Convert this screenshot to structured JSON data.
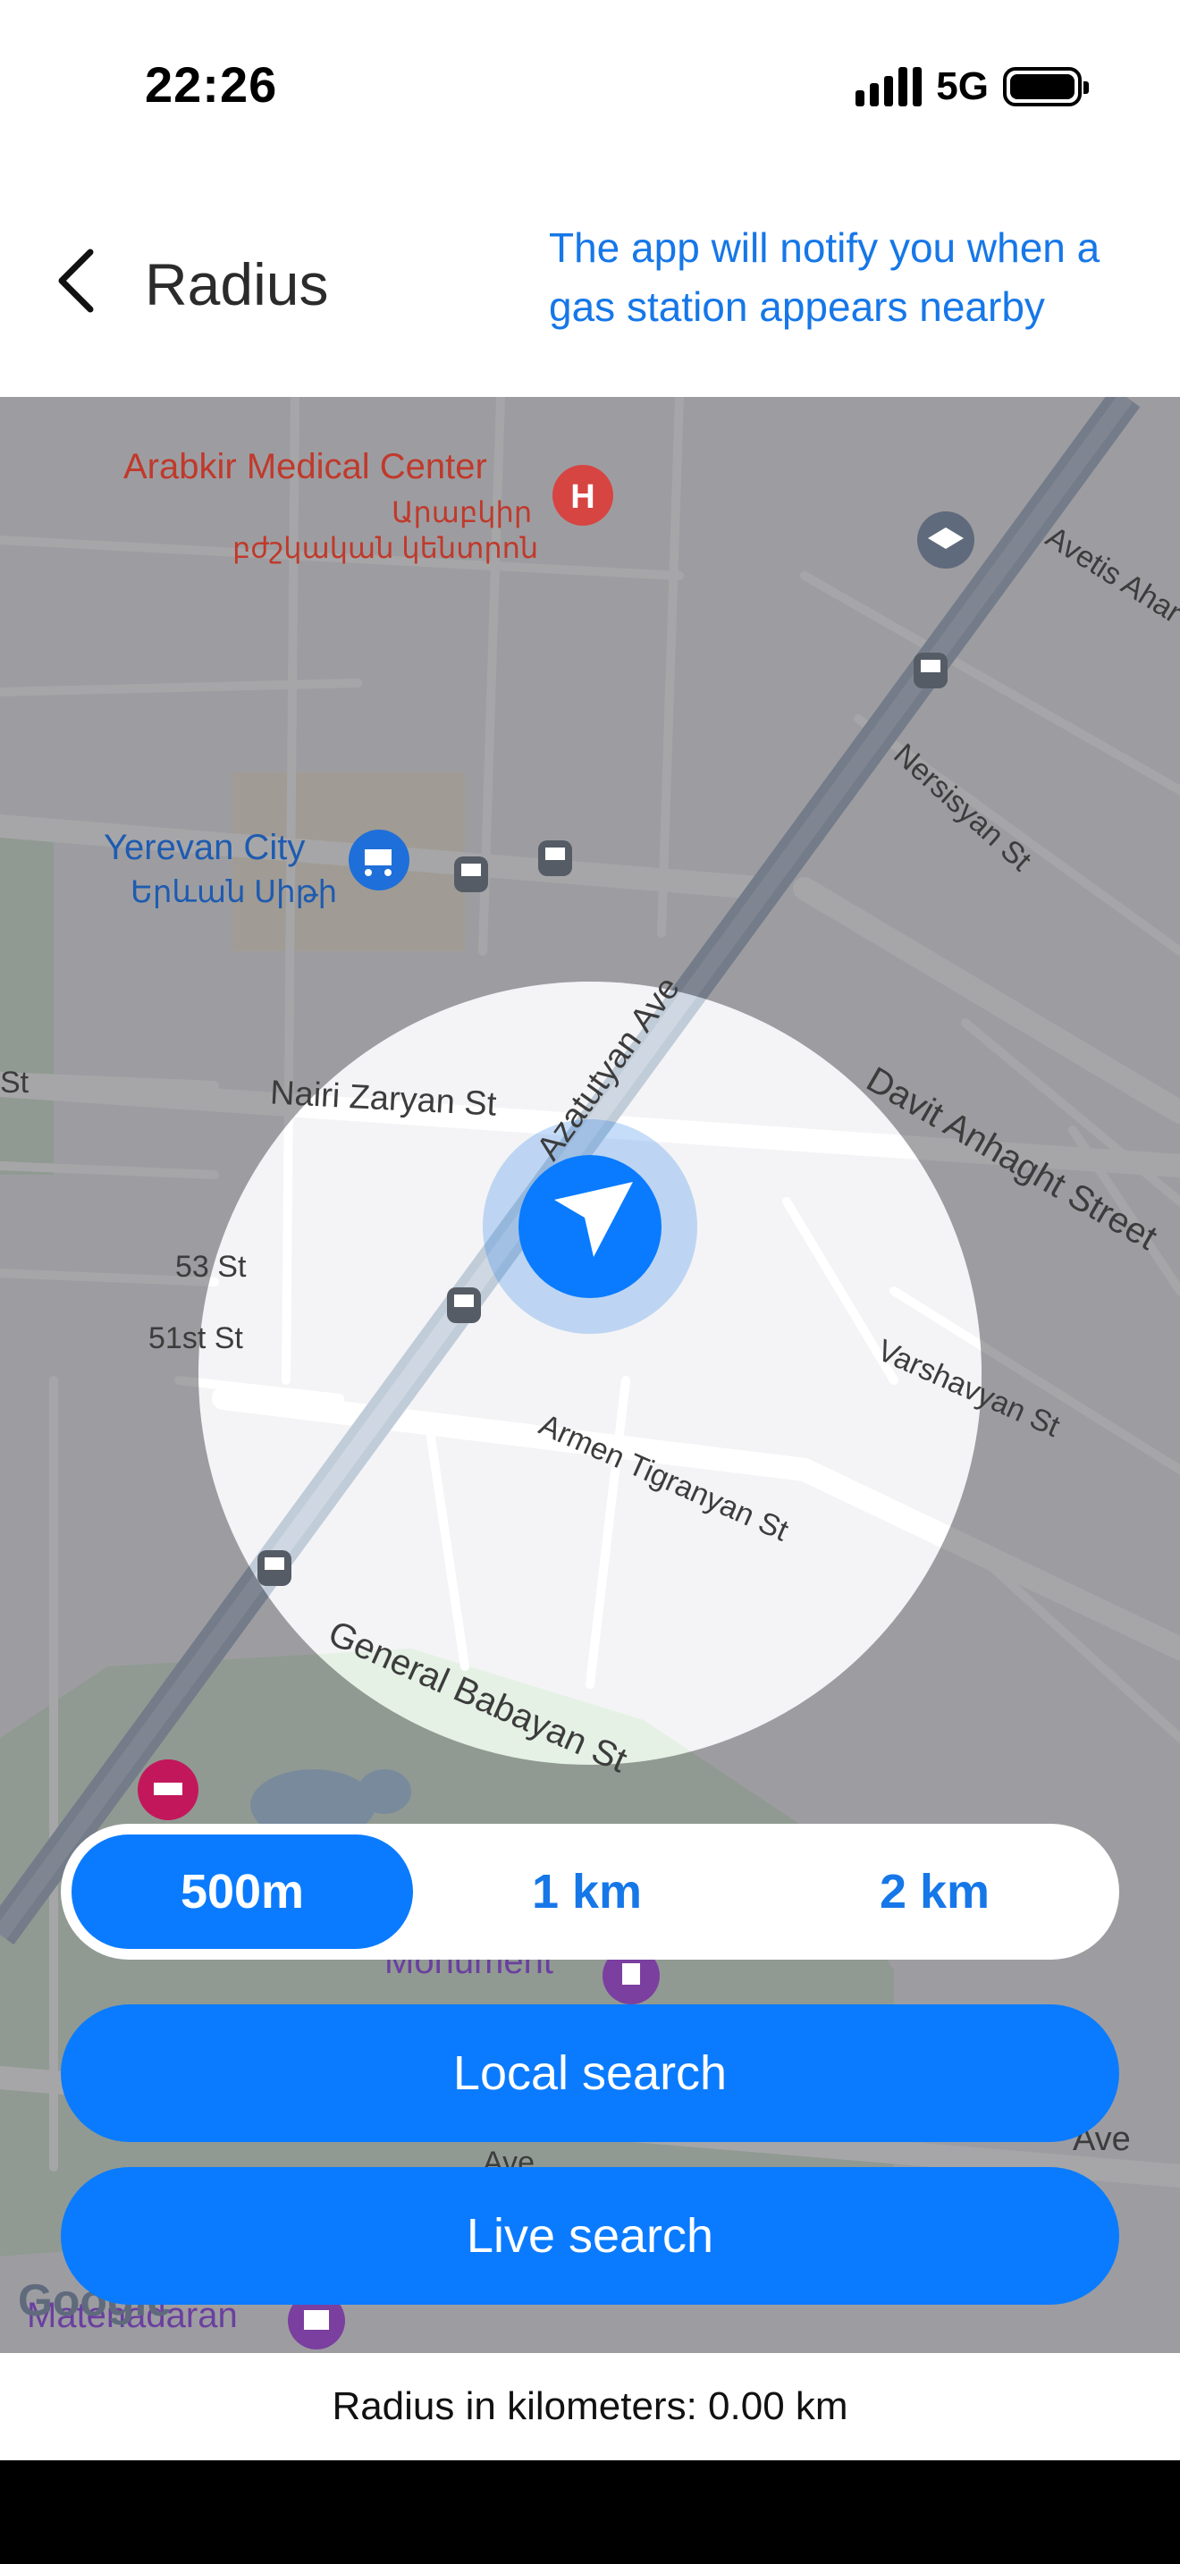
{
  "status_bar": {
    "time": "22:26",
    "network": "5G"
  },
  "header": {
    "title": "Radius",
    "hint": "The app will notify you when a gas station appears nearby",
    "back_icon": "chevron-left-icon"
  },
  "map": {
    "labels": {
      "medical_center_en": "Arabkir Medical Center",
      "medical_center_hy_1": "Արաբկիր",
      "medical_center_hy_2": "բժշկական կենտրոն",
      "yerevan_city_en": "Yerevan City",
      "yerevan_city_hy": "Երևան Սիթի",
      "nairi_zaryan": "Nairi Zaryan St",
      "azatutyan": "Azatutyan Ave",
      "davit_anhaght": "Davit Anhaght Street",
      "nersisyan": "Nersisyan St",
      "avetis": "Avetis Ahar",
      "st_53": "53 St",
      "st_51": "51st St",
      "varshavyan": "Varshavyan St",
      "armen_tigranyan": "Armen Tigranyan St",
      "general_babayan": "General Babayan St",
      "monument": "Monument",
      "ave_bottom": "Ave",
      "ave_right": "Ave",
      "matenadaran": "Matenadaran",
      "google": "Google",
      "st_left": "St"
    },
    "icons": [
      "hospital-icon",
      "school-icon",
      "bus-icon",
      "shopping-cart-icon",
      "hotel-icon",
      "monument-icon",
      "museum-icon",
      "navigation-arrow-icon"
    ],
    "colors": {
      "overlay": "#5e5e62",
      "accent": "#0a7bff"
    }
  },
  "radius_options": [
    {
      "label": "500m",
      "active": true
    },
    {
      "label": "1 km",
      "active": false
    },
    {
      "label": "2 km",
      "active": false
    }
  ],
  "buttons": {
    "local_search": "Local search",
    "live_search": "Live search"
  },
  "footer": {
    "radius_text": "Radius in kilometers: 0.00 km"
  }
}
